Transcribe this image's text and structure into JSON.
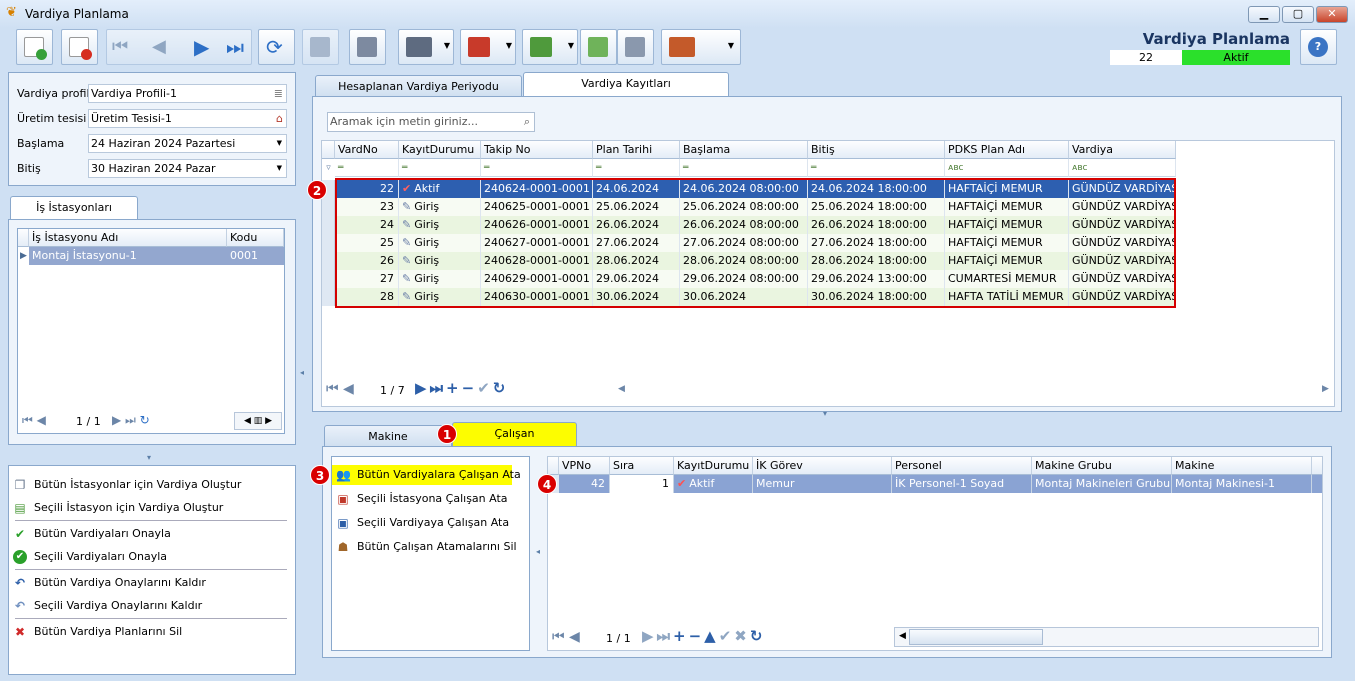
{
  "window": {
    "title": "Vardiya Planlama",
    "min": "▁",
    "max": "▢",
    "close": "✕"
  },
  "header": {
    "title": "Vardiya Planlama",
    "id": "22",
    "status": "Aktif",
    "help": "?"
  },
  "filters": [
    {
      "label": "Vardiya profili",
      "value": "Vardiya Profili-1"
    },
    {
      "label": "Üretim tesisi",
      "value": "Üretim Tesisi-1"
    },
    {
      "label": "Başlama",
      "value": "24 Haziran 2024 Pazartesi"
    },
    {
      "label": "Bitiş",
      "value": "30 Haziran 2024 Pazar"
    }
  ],
  "stations": {
    "tab": "İş İstasyonları",
    "col_name": "İş İstasyonu Adı",
    "col_code": "Kodu",
    "row_name": "Montaj İstasyonu-1",
    "row_code": "0001",
    "pager": "1 / 1"
  },
  "actions": [
    "Bütün İstasyonlar için Vardiya Oluştur",
    "Seçili İstasyon için Vardiya Oluştur",
    "Bütün Vardiyaları Onayla",
    "Seçili Vardiyaları Onayla",
    "Bütün Vardiya Onaylarını Kaldır",
    "Seçili Vardiya Onaylarını Kaldır",
    "Bütün Vardiya Planlarını Sil"
  ],
  "main_tabs": [
    "Hesaplanan Vardiya Periyodu",
    "Vardiya Kayıtları"
  ],
  "search": {
    "placeholder": "Aramak için metin giriniz..."
  },
  "grid": {
    "columns": [
      "VardNo",
      "KayıtDurumu",
      "Takip No",
      "Plan Tarihi",
      "Başlama",
      "Bitiş",
      "PDKS Plan Adı",
      "Vardiya"
    ],
    "rows": [
      [
        "22",
        "Aktif",
        "240624-0001-0001",
        "24.06.2024",
        "24.06.2024 08:00:00",
        "24.06.2024 18:00:00",
        "HAFTAİÇİ MEMUR",
        "GÜNDÜZ VARDİYASI"
      ],
      [
        "23",
        "Giriş",
        "240625-0001-0001",
        "25.06.2024",
        "25.06.2024 08:00:00",
        "25.06.2024 18:00:00",
        "HAFTAİÇİ MEMUR",
        "GÜNDÜZ VARDİYASI"
      ],
      [
        "24",
        "Giriş",
        "240626-0001-0001",
        "26.06.2024",
        "26.06.2024 08:00:00",
        "26.06.2024 18:00:00",
        "HAFTAİÇİ MEMUR",
        "GÜNDÜZ VARDİYASI"
      ],
      [
        "25",
        "Giriş",
        "240627-0001-0001",
        "27.06.2024",
        "27.06.2024 08:00:00",
        "27.06.2024 18:00:00",
        "HAFTAİÇİ MEMUR",
        "GÜNDÜZ VARDİYASI"
      ],
      [
        "26",
        "Giriş",
        "240628-0001-0001",
        "28.06.2024",
        "28.06.2024 08:00:00",
        "28.06.2024 18:00:00",
        "HAFTAİÇİ MEMUR",
        "GÜNDÜZ VARDİYASI"
      ],
      [
        "27",
        "Giriş",
        "240629-0001-0001",
        "29.06.2024",
        "29.06.2024 08:00:00",
        "29.06.2024 13:00:00",
        "CUMARTESİ MEMUR",
        "GÜNDÜZ VARDİYASI"
      ],
      [
        "28",
        "Giriş",
        "240630-0001-0001",
        "30.06.2024",
        "30.06.2024",
        "30.06.2024 18:00:00",
        "HAFTA TATİLİ MEMUR",
        "GÜNDÜZ VARDİYASI"
      ]
    ],
    "pager": "1 / 7"
  },
  "bottom_tabs": [
    "Makine",
    "Çalışan"
  ],
  "assign_actions": [
    "Bütün Vardiyalara Çalışan Ata",
    "Seçili İstasyona Çalışan Ata",
    "Seçili Vardiyaya Çalışan Ata",
    "Bütün Çalışan Atamalarını Sil"
  ],
  "emp_grid": {
    "columns": [
      "VPNo",
      "Sıra",
      "KayıtDurumu",
      "İK Görev",
      "Personel",
      "Makine Grubu",
      "Makine"
    ],
    "row": [
      "42",
      "1",
      "Aktif",
      "Memur",
      "İK Personel-1 Soyad",
      "Montaj Makineleri Grubu",
      "Montaj Makinesi-1"
    ],
    "pager": "1 / 1"
  },
  "badges": [
    "1",
    "2",
    "3",
    "4"
  ]
}
